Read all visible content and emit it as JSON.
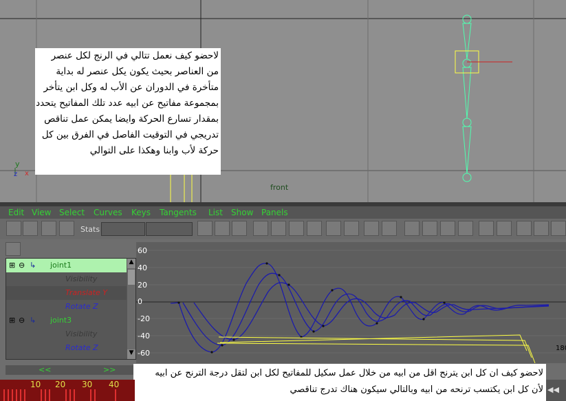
{
  "viewport": {
    "view_label": "front",
    "axis_y": "y",
    "axis_z": "z",
    "axis_x": "x",
    "note_lines": [
      "لاحضو كيف نعمل تتالي في الرنج لكل عنصر",
      "من العناصر بحيث يكون يكل عنصر له بداية",
      "متأخرة في الدوران عن الأب له وكل ابن يتأخر",
      "بمجموعة مفاتيح عن ابيه عدد تلك المفاتيح يتحدد",
      "بمقدار تسارع الحركة وايضا يمكن عمل تناقص",
      "تدريجي في التوقيت الفاصل في الفرق بين كل",
      "حركة لأب وابنا وهكذا على التوالي"
    ]
  },
  "menu": [
    "Edit",
    "View",
    "Select",
    "Curves",
    "Keys",
    "Tangents",
    "List",
    "Show",
    "Panels"
  ],
  "toolbar": {
    "stats_label": "Stats"
  },
  "outliner": {
    "items": [
      {
        "label": "joint1",
        "type": "node"
      },
      {
        "label": "Visibility",
        "type": "attr"
      },
      {
        "label": "Translate Y",
        "type": "attr-red"
      },
      {
        "label": "Rotate Z",
        "type": "attr-blue"
      },
      {
        "label": "joint3",
        "type": "node"
      },
      {
        "label": "Visibility",
        "type": "attr"
      },
      {
        "label": "Rotate Z",
        "type": "attr-blue"
      }
    ],
    "scroll_left": "<<",
    "scroll_right": ">>"
  },
  "graph": {
    "y_ticks": [
      "60",
      "40",
      "20",
      "0",
      "-20",
      "-40",
      "-60"
    ],
    "x_tick_visible": "180"
  },
  "note2_lines": [
    "لاحضو كيف ان كل ابن يترنح اقل من ابيه من خلال عمل سكيل للمفاتيح لكل ابن لتقل درجة الترنح عن ابيه",
    "لأن كل ابن يكتسب ترنحه من ابيه وبالتالي سيكون هناك تدرج تناقصي"
  ],
  "timeline": {
    "ticks": [
      "10",
      "20",
      "30",
      "40"
    ]
  },
  "colors": {
    "menu_green": "#35d235",
    "curve_blue": "#1c1caa",
    "guide_yellow": "#ffff44",
    "joint_green": "#4fffb0"
  }
}
